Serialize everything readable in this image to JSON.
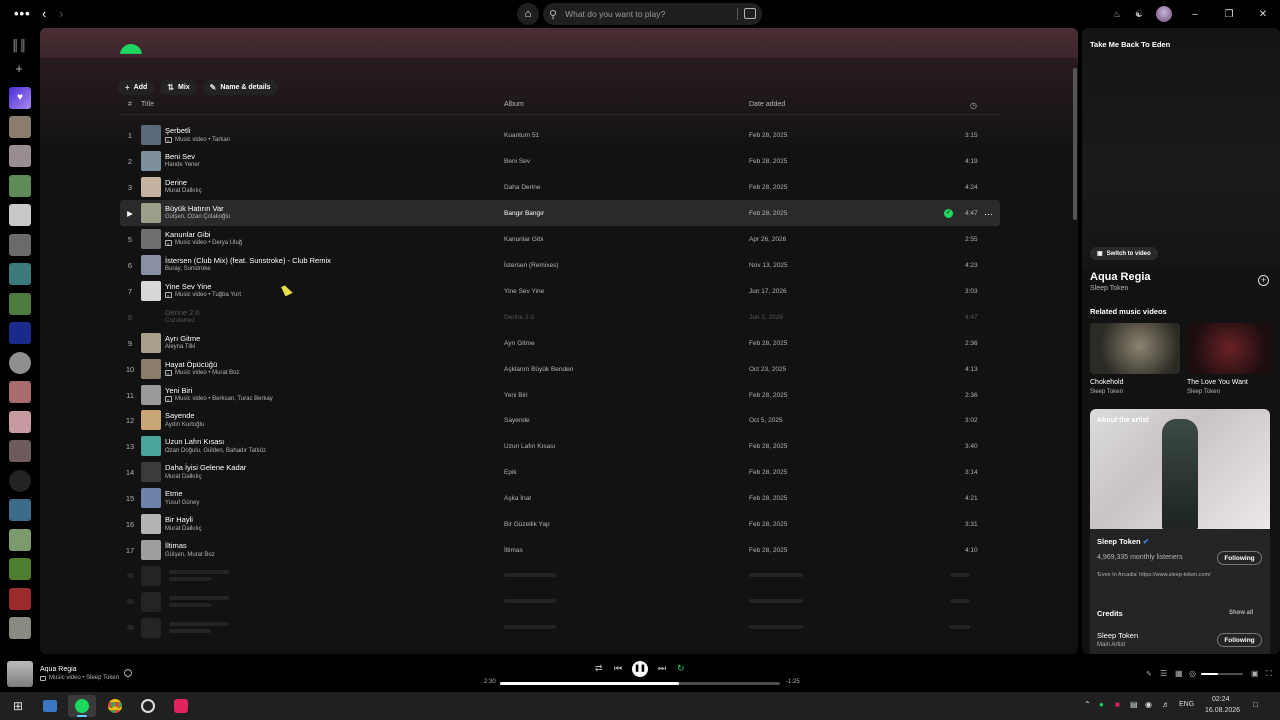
{
  "topbar": {
    "search_placeholder": "What do you want to play?"
  },
  "playlist": {
    "buttons": [
      {
        "label": "Add",
        "icon": "plus-icon"
      },
      {
        "label": "Mix",
        "icon": "mix-icon"
      },
      {
        "label": "Name & details",
        "icon": "pencil-icon"
      }
    ],
    "columns": {
      "num": "#",
      "title": "Title",
      "album": "Album",
      "date": "Date added"
    },
    "tracks": [
      {
        "num": "1",
        "title": "Şerbetli",
        "subtitle": "Music video • Tarkan",
        "video": true,
        "album": "Kuantum 51",
        "date": "Feb 28, 2025",
        "duration": "3:15",
        "color": "#5a6a7a"
      },
      {
        "num": "2",
        "title": "Beni Sev",
        "subtitle": "Hande Yener",
        "video": false,
        "album": "Beni Sev",
        "date": "Feb 28, 2025",
        "duration": "4:19",
        "color": "#7d8f9a"
      },
      {
        "num": "3",
        "title": "Derine",
        "subtitle": "Murat Dalkılıç",
        "video": false,
        "album": "Daha Derine",
        "date": "Feb 28, 2025",
        "duration": "4:24",
        "color": "#c6b2a0"
      },
      {
        "num": "",
        "title": "Büyük Hatırın Var",
        "subtitle": "Gülşen, Ozan Çolakoğlu",
        "video": false,
        "album": "Bangır Bangır",
        "date": "Feb 28, 2025",
        "duration": "4:47",
        "color": "#9aa089",
        "active": true
      },
      {
        "num": "5",
        "title": "Kanunlar Gibi",
        "subtitle": "Music video • Derya Uluğ",
        "video": true,
        "album": "Kanunlar Gibi",
        "date": "Apr 26, 2026",
        "duration": "2:55",
        "color": "#6f6f6f"
      },
      {
        "num": "6",
        "title": "İstersen (Club Mix) (feat. Sunstroke) - Club Remix",
        "subtitle": "Buray, Sunstroke",
        "video": false,
        "album": "İstersen (Remixes)",
        "date": "Nov 13, 2025",
        "duration": "4:23",
        "color": "#8a8fa6"
      },
      {
        "num": "7",
        "title": "Yine Sev Yine",
        "subtitle": "Music video • Tuğba Yurt",
        "video": true,
        "album": "Yine Sev Yine",
        "date": "Jun 17, 2026",
        "duration": "3:03",
        "color": "#d8d8d8"
      },
      {
        "num": "8",
        "title": "Derine 2.0",
        "subtitle": "Cozulemez",
        "video": false,
        "album": "Derine 2.0",
        "date": "Jun 2, 2026",
        "duration": "4:47",
        "color": "#121212",
        "disabled": true
      },
      {
        "num": "9",
        "title": "Ayrı Gitme",
        "subtitle": "Aleyna Tilki",
        "video": false,
        "album": "Ayrı Gitme",
        "date": "Feb 28, 2025",
        "duration": "2:36",
        "color": "#a89f8c"
      },
      {
        "num": "10",
        "title": "Hayat Öpücüğü",
        "subtitle": "Music video • Murat Boz",
        "video": true,
        "album": "Aşklarım Büyük Benden",
        "date": "Oct 23, 2025",
        "duration": "4:13",
        "color": "#8b7d6b"
      },
      {
        "num": "11",
        "title": "Yeni Biri",
        "subtitle": "Music video • Berksan, Turac Berkay",
        "video": true,
        "album": "Yeni Biri",
        "date": "Feb 28, 2025",
        "duration": "2:36",
        "color": "#9a9a9a"
      },
      {
        "num": "12",
        "title": "Sayende",
        "subtitle": "Aydın Kurtoğlu",
        "video": false,
        "album": "Sayende",
        "date": "Oct 5, 2025",
        "duration": "3:02",
        "color": "#c9a676"
      },
      {
        "num": "13",
        "title": "Uzun Lafın Kısası",
        "subtitle": "Ozan Doğulu, Gülden, Bahadır Tatlıöz",
        "video": false,
        "album": "Uzun Lafın Kısası",
        "date": "Feb 28, 2025",
        "duration": "3:40",
        "color": "#4aa39c"
      },
      {
        "num": "14",
        "title": "Daha İyisi Gelene Kadar",
        "subtitle": "Murat Dalkılıç",
        "video": false,
        "album": "Epik",
        "date": "Feb 28, 2025",
        "duration": "3:14",
        "color": "#3b3b3b"
      },
      {
        "num": "15",
        "title": "Etme",
        "subtitle": "Yusuf Güney",
        "video": false,
        "album": "Aşka İnat",
        "date": "Feb 28, 2025",
        "duration": "4:21",
        "color": "#6d84a8"
      },
      {
        "num": "16",
        "title": "Bir Hayli",
        "subtitle": "Murat Dalkılıç",
        "video": false,
        "album": "Bir Güzellik Yap",
        "date": "Feb 28, 2025",
        "duration": "3:31",
        "color": "#b4b4b4"
      },
      {
        "num": "17",
        "title": "İltimas",
        "subtitle": "Gülşen, Murat Boz",
        "video": false,
        "album": "İltimas",
        "date": "Feb 28, 2025",
        "duration": "4:10",
        "color": "#9e9e9e"
      }
    ]
  },
  "right_panel": {
    "header": "Take Me Back To Eden",
    "switch_video": "Switch to video",
    "track_title": "Aqua Regia",
    "track_artist": "Sleep Token",
    "related_heading": "Related music videos",
    "related": [
      {
        "title": "Chokehold",
        "artist": "Sleep Token"
      },
      {
        "title": "The Love You Want",
        "artist": "Sleep Token"
      }
    ],
    "about_heading": "About the artist",
    "artist_name": "Sleep Token",
    "listeners": "4,969,335 monthly listeners",
    "following": "Following",
    "bio": "'Even In Arcadia' https://www.sleep-token.com/",
    "credits_heading": "Credits",
    "show_all": "Show all",
    "credit_name": "Sleep Token",
    "credit_role": "Main Artist",
    "credit_following": "Following"
  },
  "player": {
    "title": "Aqua Regia",
    "subtitle": "Music video • Sleep Token",
    "elapsed": "2:30",
    "remaining": "-1:25",
    "progress": 0.64,
    "volume": 0.4
  },
  "taskbar": {
    "lang": "ENG",
    "time": "02:24",
    "date": "16.08.2026"
  },
  "colors": {
    "accent": "#1ed760",
    "header_tint": "#4a2e34"
  }
}
